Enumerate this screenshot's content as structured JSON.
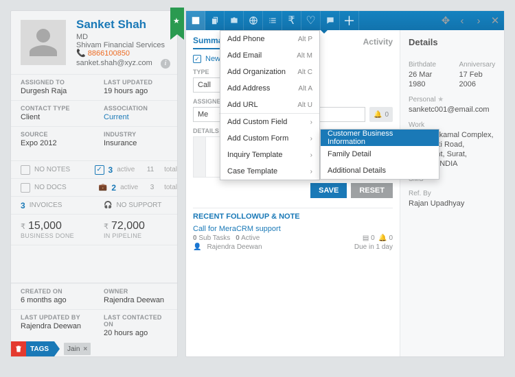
{
  "profile": {
    "name": "Sanket Shah",
    "title": "MD",
    "company": "Shivam Financial Services",
    "phone_icon": "📞",
    "phone": "8866100850",
    "email": "sanket.shah@xyz.com"
  },
  "facts": {
    "assigned_to_label": "ASSIGNED TO",
    "assigned_to": "Durgesh Raja",
    "last_updated_label": "LAST UPDATED",
    "last_updated": "19 hours ago",
    "contact_type_label": "CONTACT TYPE",
    "contact_type": "Client",
    "association_label": "ASSOCIATION",
    "association": "Current",
    "source_label": "SOURCE",
    "source": "Expo 2012",
    "industry_label": "INDUSTRY",
    "industry": "Insurance"
  },
  "stats": {
    "no_notes": "NO NOTES",
    "followups_active_n": "3",
    "followups_active": "active",
    "followups_total_n": "11",
    "followups_total": "total",
    "no_docs": "NO DOCS",
    "cases_active_n": "2",
    "cases_active": "active",
    "cases_total_n": "3",
    "cases_total": "total",
    "invoices_n": "3",
    "invoices": "INVOICES",
    "no_support": "NO SUPPORT"
  },
  "money": {
    "biz_done": "15,000",
    "biz_done_label": "BUSINESS DONE",
    "pipeline": "72,000",
    "pipeline_label": "IN PIPELINE",
    "rupee": "₹"
  },
  "meta": {
    "created_on_label": "CREATED ON",
    "created_on": "6 months ago",
    "owner_label": "OWNER",
    "owner": "Rajendra Deewan",
    "last_updated_by_label": "LAST UPDATED BY",
    "last_updated_by": "Rajendra Deewan",
    "last_contacted_on_label": "LAST CONTACTED ON",
    "last_contacted_on": "20 hours ago"
  },
  "tags": {
    "label": "TAGS",
    "tag1": "Jain"
  },
  "tabs": {
    "summary": "Summary",
    "activity": "Activity"
  },
  "followup": {
    "new_label": "New Followup",
    "type_label": "TYPE",
    "type_value": "Call",
    "assigned_label": "ASSIGNED TO",
    "assigned_value": "Me",
    "bell_count": "0",
    "details_label": "DETAILS",
    "save": "SAVE",
    "reset": "RESET"
  },
  "recent": {
    "header": "RECENT FOLLOWUP & NOTE",
    "item_title": "Call for MeraCRM support",
    "sub1_n": "0",
    "sub1": "Sub Tasks",
    "sub2_n": "0",
    "sub2": "Active",
    "list_n": "0",
    "bell_n": "0",
    "owner": "Rajendra Deewan",
    "due": "Due in 1 day"
  },
  "details": {
    "header": "Details",
    "birthdate_label": "Birthdate",
    "birthdate": "26 Mar 1980",
    "anniversary_label": "Anniversary",
    "anniversary": "17 Feb 2006",
    "personal_label": "Personal",
    "personal_email": "sanketc001@email.com",
    "work_label": "Work",
    "work_addr": "A 10. Raikamal Complex, Panchbati Road, Parlepoint, Surat, Gujarat, INDIA",
    "sms_label": "SMS",
    "refby_label": "Ref. By",
    "refby": "Rajan Upadhyay"
  },
  "menu": {
    "add_phone": "Add Phone",
    "alt_p": "Alt P",
    "add_email": "Add Email",
    "alt_m": "Alt M",
    "add_org": "Add Organization",
    "alt_c": "Alt C",
    "add_addr": "Add Address",
    "alt_a": "Alt A",
    "add_url": "Add URL",
    "alt_u": "Alt U",
    "add_cf": "Add Custom Field",
    "add_form": "Add Custom Form",
    "inquiry": "Inquiry Template",
    "case": "Case Template"
  },
  "submenu": {
    "cbi": "Customer Business Information",
    "family": "Family Detail",
    "addl": "Additional Details"
  }
}
